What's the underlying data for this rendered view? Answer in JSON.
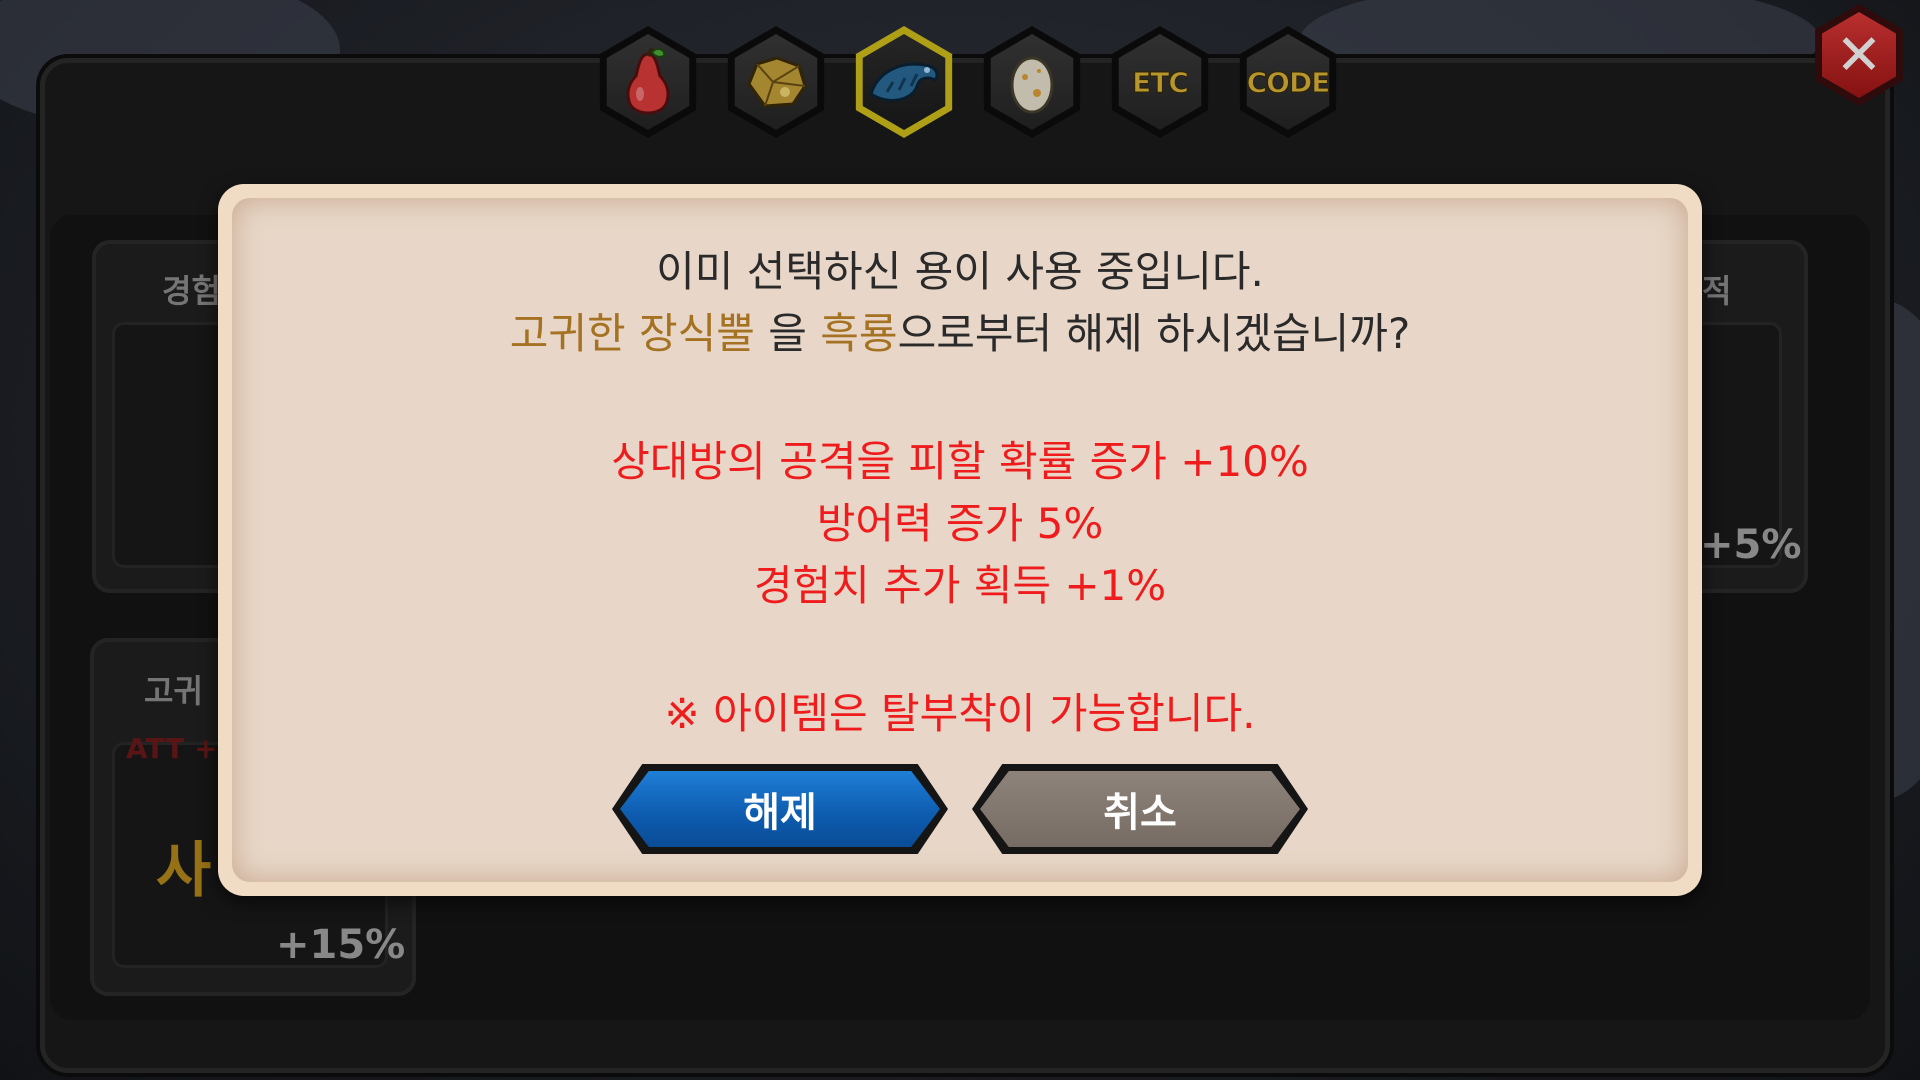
{
  "tabs": [
    {
      "name": "fruit",
      "icon": "pear-icon",
      "label": ""
    },
    {
      "name": "ore",
      "icon": "gold-ore-icon",
      "label": ""
    },
    {
      "name": "dragon",
      "icon": "dragon-icon",
      "label": "",
      "active": true
    },
    {
      "name": "egg",
      "icon": "egg-icon",
      "label": ""
    },
    {
      "name": "etc",
      "icon": "",
      "label": "ETC"
    },
    {
      "name": "code",
      "icon": "",
      "label": "CODE"
    }
  ],
  "close_icon": "close-icon",
  "background": {
    "left_card_label": "경험",
    "right_card_label": "적",
    "right_card_pct": "+5%",
    "left_lower_label": "고귀",
    "left_lower_red": "ATT +",
    "left_lower_big": "사",
    "left_lower_pct": "+15%"
  },
  "dialog": {
    "line1": "이미 선택하신 용이 사용 중입니다.",
    "item_name": "고귀한 장식뿔",
    "particle1": " 을 ",
    "dragon_name": "흑룡",
    "line2_rest": "으로부터 해제 하시겠습니까?",
    "effects": [
      "상대방의 공격을 피할 확률 증가 +10%",
      "방어력 증가 5%",
      "경험치 추가 획득 +1%"
    ],
    "note": "※ 아이템은 탈부착이 가능합니다.",
    "confirm_label": "해제",
    "cancel_label": "취소"
  },
  "colors": {
    "gold": "#a47222",
    "red": "#ee1c1c",
    "confirm_blue": "#0e5db1",
    "cancel_gray": "#7d736b"
  }
}
